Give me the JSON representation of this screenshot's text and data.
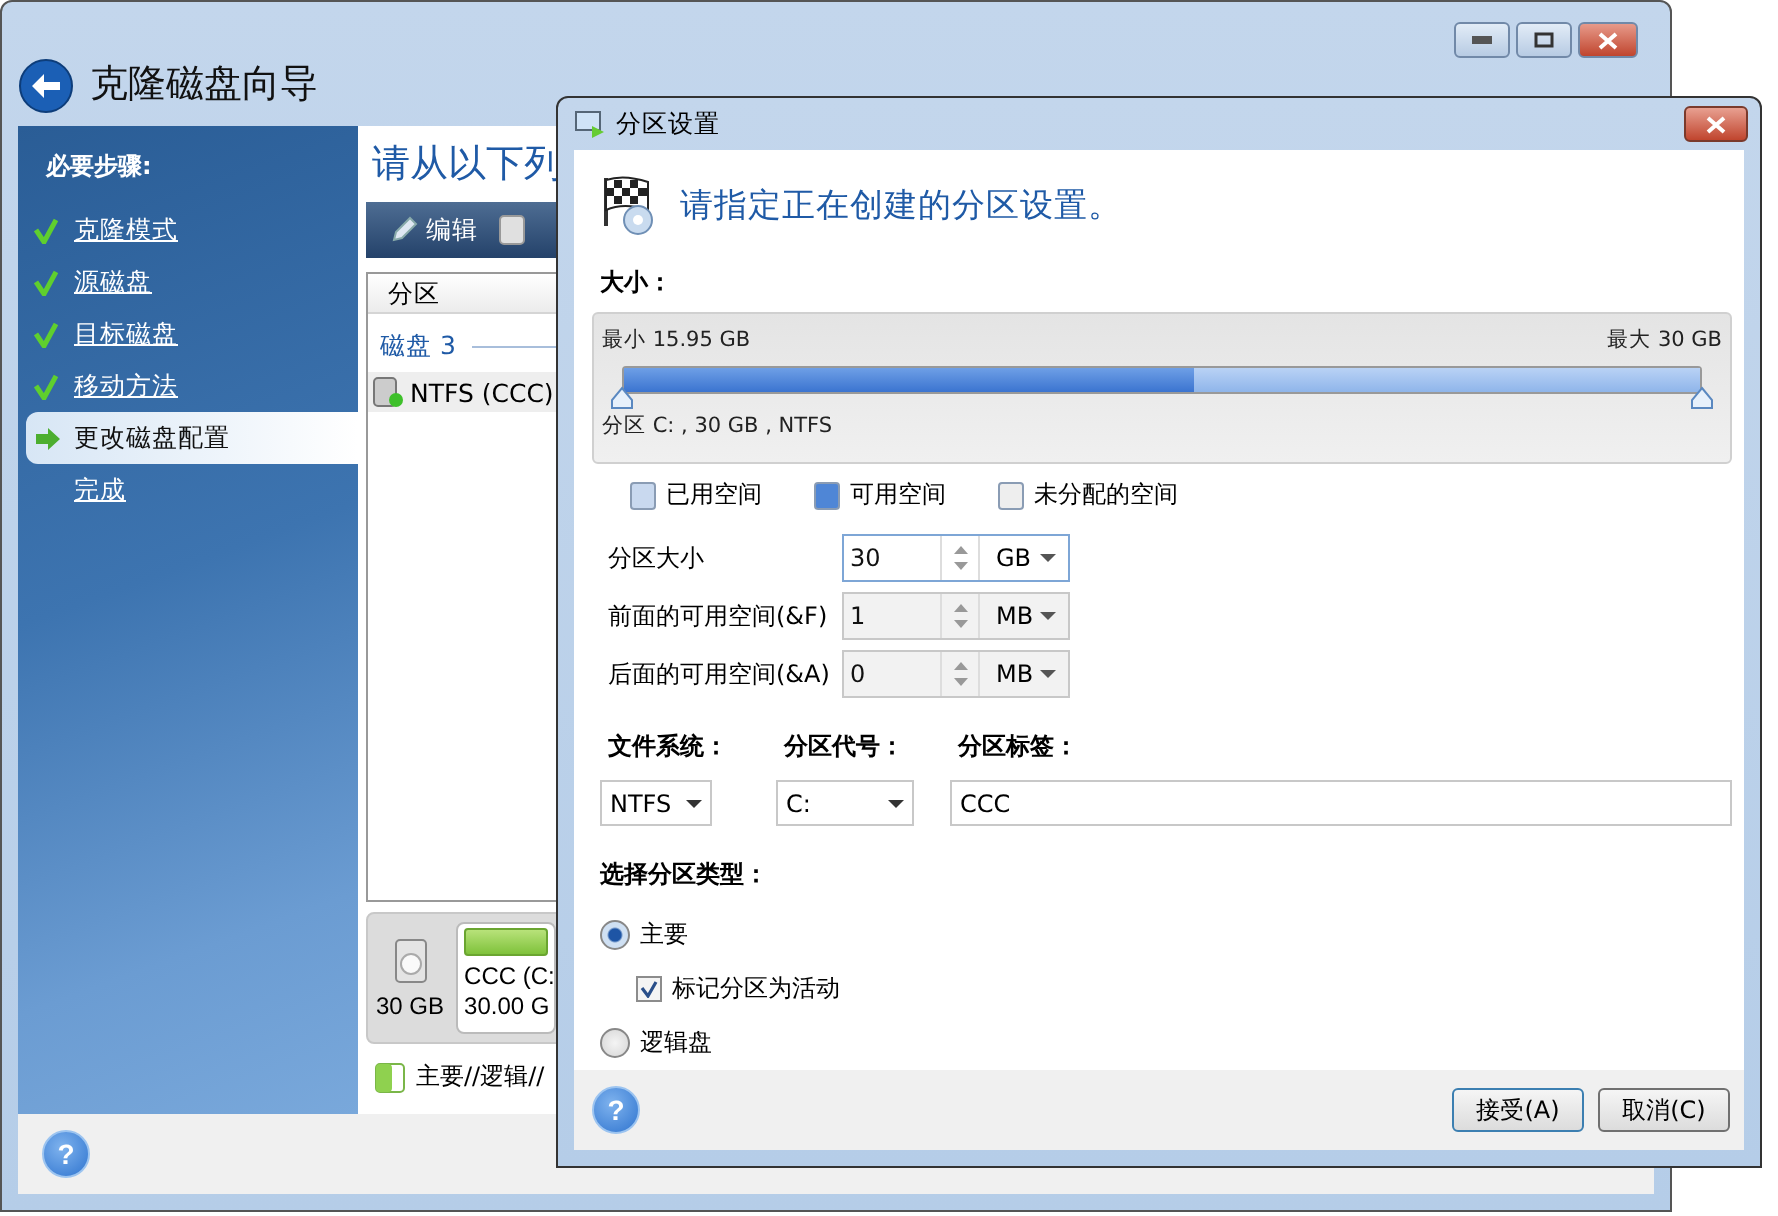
{
  "main_window": {
    "title": "克隆磁盘向导",
    "sidebar": {
      "heading": "必要步骤:",
      "steps": [
        {
          "label": "克隆模式",
          "kind": "done",
          "selected": false
        },
        {
          "label": "源磁盘",
          "kind": "done",
          "selected": false
        },
        {
          "label": "目标磁盘",
          "kind": "done",
          "selected": false
        },
        {
          "label": "移动方法",
          "kind": "done",
          "selected": false
        },
        {
          "label": "更改磁盘配置",
          "kind": "current",
          "selected": true
        },
        {
          "label": "完成",
          "kind": "todo",
          "selected": false
        }
      ]
    },
    "content": {
      "heading": "请从以下列",
      "toolbar": [
        {
          "label": "编辑"
        }
      ],
      "table": {
        "columns": [
          "分区"
        ],
        "group": "磁盘 3",
        "rows": [
          {
            "label": "NTFS (CCC)",
            "selected": true
          }
        ]
      },
      "disk_map": {
        "size": "30 GB",
        "partition_name": "CCC (C:",
        "partition_size": "30.00 G",
        "legend": "主要//逻辑//"
      }
    },
    "help": "?"
  },
  "dialog": {
    "title": "分区设置",
    "heading": "请指定正在创建的分区设置。",
    "size_label": "大小：",
    "slider": {
      "min_label": "最小 15.95 GB",
      "max_label": "最大 30 GB",
      "partition": {
        "level": 1
      },
      "used_space": {
        "level": 0.53
      },
      "caption": "分区 C: , 30 GB , NTFS"
    },
    "legend": [
      {
        "label": "已用空间",
        "color": "#c9d9ef"
      },
      {
        "label": "可用空间",
        "color": "#4f86d6"
      },
      {
        "label": "未分配的空间",
        "color": "#eeeeee"
      }
    ],
    "spin_fields": [
      {
        "label": "分区大小",
        "value": "30",
        "unit": "GB",
        "disabled": false
      },
      {
        "label": "前面的可用空间(&F)",
        "value": "1",
        "unit": "MB",
        "disabled": true
      },
      {
        "label": "后面的可用空间(&A)",
        "value": "0",
        "unit": "MB",
        "disabled": true
      }
    ],
    "file_system": {
      "label": "文件系统：",
      "value": "NTFS"
    },
    "drive_letter": {
      "label": "分区代号：",
      "value": "C:"
    },
    "partition_label": {
      "label": "分区标签：",
      "value": "CCC"
    },
    "type_label": "选择分区类型：",
    "types": [
      {
        "label": "主要",
        "kind": "radio",
        "selected": true
      },
      {
        "label": "标记分区为活动",
        "kind": "checkbox",
        "checked": true
      },
      {
        "label": "逻辑盘",
        "kind": "radio",
        "selected": false
      }
    ],
    "help": "?",
    "buttons": [
      {
        "label": "接受(A)",
        "default": true
      },
      {
        "label": "取消(C)",
        "default": false
      }
    ]
  }
}
